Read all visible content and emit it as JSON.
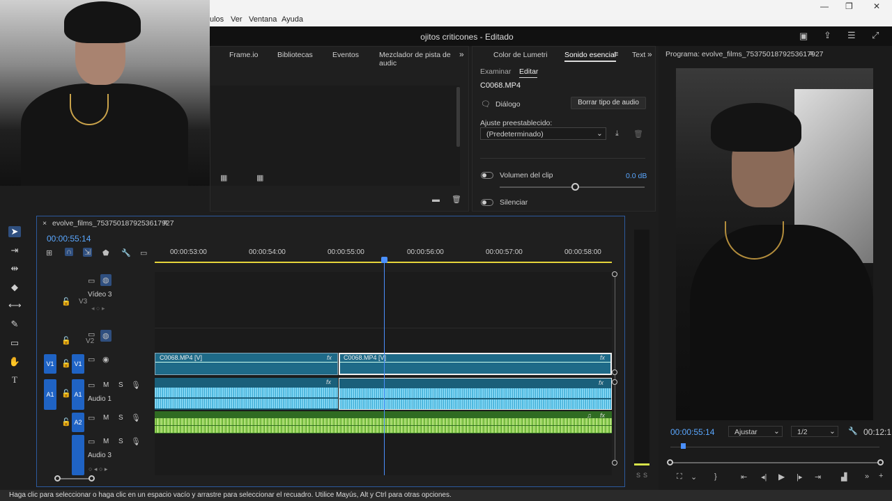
{
  "menubar": {
    "items": [
      "ulos",
      "Ver",
      "Ventana",
      "Ayuda"
    ],
    "minimize": "—",
    "maximize": "❐",
    "close": "✕"
  },
  "titlebar": {
    "title": "ojitos criticones - Editado"
  },
  "source_panel": {
    "tabs": [
      "Frame.io",
      "Bibliotecas",
      "Eventos",
      "Mezclador de pista de audic"
    ],
    "overflow": "»"
  },
  "essential": {
    "tabs": [
      "Color de Lumetri",
      "Sonido esencial",
      "Text"
    ],
    "subtabs": [
      "Examinar",
      "Editar"
    ],
    "clip_name": "C0068.MP4",
    "type_label": "Diálogo",
    "clear_button": "Borrar tipo de audio",
    "preset_label": "Ajuste preestablecido:",
    "preset_value": "(Predeterminado)",
    "clip_volume_label": "Volumen del clip",
    "clip_volume_value": "0.0 dB",
    "clip_volume_level": 0.52,
    "mute_label": "Silenciar"
  },
  "program": {
    "title": "Programa: evolve_films_7537501879253617927",
    "timecode": "00:00:55:14",
    "fit": "Ajustar",
    "resolution": "1/2",
    "duration": "00:12:1"
  },
  "timeline": {
    "sequence_name": "evolve_films_7537501879253617927",
    "timecode": "00:00:55:14",
    "ruler": [
      "00:00:53:00",
      "00:00:54:00",
      "00:00:55:00",
      "00:00:56:00",
      "00:00:57:00",
      "00:00:58:00"
    ],
    "tracks": {
      "v3": {
        "id": "V3",
        "name": "Vídeo 3"
      },
      "v2": {
        "id": "V2"
      },
      "v1": {
        "id": "V1",
        "src": "V1"
      },
      "a1": {
        "id": "A1",
        "src": "A1",
        "name": "Audio 1"
      },
      "a2": {
        "id": "A2"
      },
      "a3": {
        "name": "Audio 3"
      }
    },
    "clips": {
      "v1a": "C0068.MP4 [V]",
      "v1b": "C0068.MP4 [V]"
    },
    "meter_labels": [
      "S",
      "S"
    ],
    "track_buttons": {
      "mute": "M",
      "solo": "S"
    },
    "fx": "fx"
  },
  "status": {
    "text": "Haga clic para seleccionar o haga clic en un espacio vacío y arrastre para seleccionar el recuadro. Utilice Mayús, Alt y Ctrl para otras opciones."
  },
  "colors": {
    "accent": "#2f7ff0",
    "timecode": "#5aa7ff",
    "clip_video": "#1e6a88",
    "clip_audio_green": "#2f6b22"
  }
}
